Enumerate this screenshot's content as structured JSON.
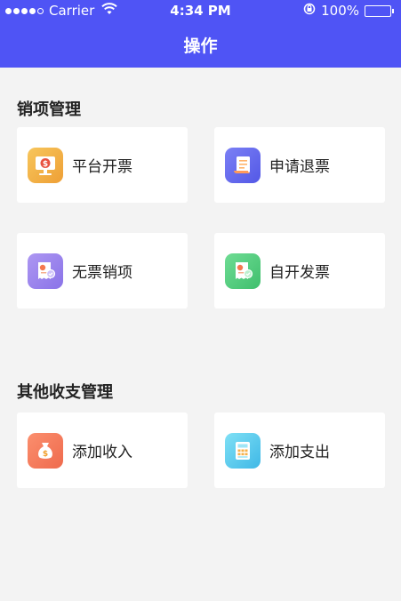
{
  "status_bar": {
    "carrier": "Carrier",
    "time": "4:34 PM",
    "battery": "100%"
  },
  "nav": {
    "title": "操作"
  },
  "sections": [
    {
      "title": "销项管理",
      "items": [
        {
          "label": "平台开票",
          "icon": "invoice-screen-icon",
          "color": "#f3b84a"
        },
        {
          "label": "申请退票",
          "icon": "refund-document-icon",
          "color": "#6a6ff2"
        },
        {
          "label": "无票销项",
          "icon": "no-invoice-receipt-icon",
          "color": "#9a84ee"
        },
        {
          "label": "自开发票",
          "icon": "self-issue-invoice-icon",
          "color": "#4fcf7f"
        }
      ]
    },
    {
      "title": "其他收支管理",
      "items": [
        {
          "label": "添加收入",
          "icon": "money-bag-icon",
          "color": "#f57a5a"
        },
        {
          "label": "添加支出",
          "icon": "calculator-icon",
          "color": "#52c6ee"
        }
      ]
    }
  ]
}
